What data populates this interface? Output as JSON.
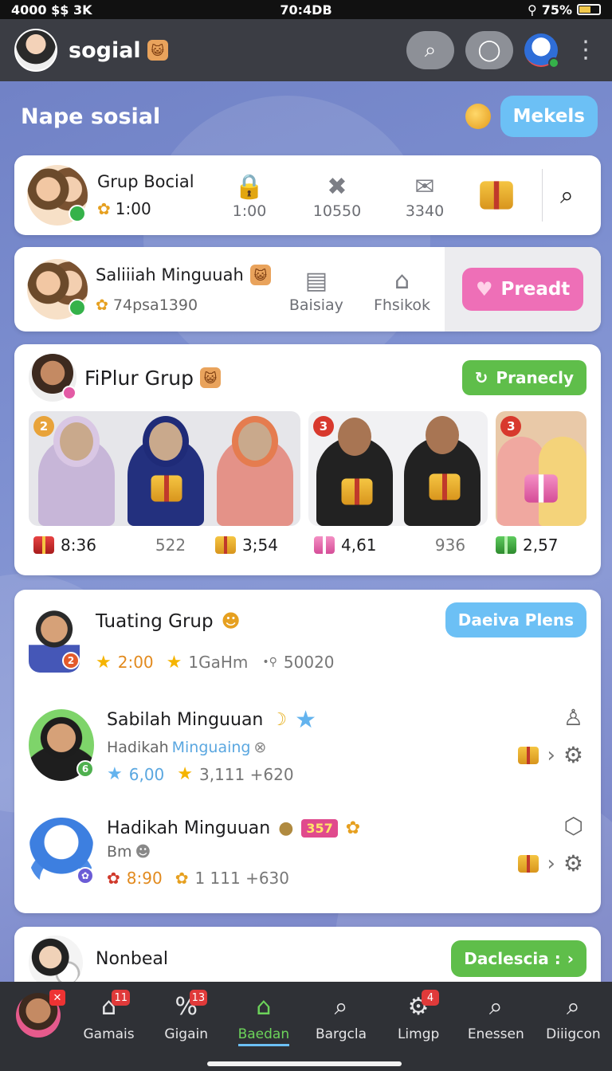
{
  "status_bar": {
    "left": "4000 $$ 3K",
    "time": "70:4DB",
    "right": "75%"
  },
  "app_bar": {
    "title": "sogial",
    "title_emoji": "😺"
  },
  "page": {
    "title": "Nape sosial",
    "action_button": "Mekels"
  },
  "card1": {
    "title": "Grup Bocial",
    "sub_value": "1:00",
    "stats": [
      {
        "icon": "lock-icon",
        "glyph": "🔒",
        "value": "1:00"
      },
      {
        "icon": "tools-icon",
        "glyph": "✖",
        "value": "10550"
      },
      {
        "icon": "mail-icon",
        "glyph": "✉",
        "value": "3340"
      }
    ]
  },
  "card2": {
    "title": "Saliiiah Minguuah",
    "sub_value": "74psa1390",
    "stats": [
      {
        "icon": "document-icon",
        "glyph": "▤",
        "label": "Baisiay"
      },
      {
        "icon": "home-icon",
        "glyph": "⌂",
        "label": "Fhsikok"
      }
    ],
    "button": "Preadt"
  },
  "card3": {
    "title": "FiPlur Grup",
    "button": "Pranecly",
    "photo_badges": [
      "2",
      "3",
      "3"
    ],
    "stats": [
      {
        "gift": "red",
        "value": "8:36"
      },
      {
        "gift": "",
        "value": "522"
      },
      {
        "gift": "gold",
        "value": "3;54"
      },
      {
        "gift": "pink",
        "value": "4,61"
      },
      {
        "gift": "",
        "value": "936"
      },
      {
        "gift": "green",
        "value": "2,57"
      }
    ]
  },
  "card4": {
    "header": {
      "title": "Tuating Grup",
      "button": "Daeiva Plens",
      "badge": "2",
      "stat1": "2:00",
      "stat2": "1GaHm",
      "stat3": "50020"
    },
    "row1": {
      "title": "Sabilah Minguuan",
      "sub_prefix": "Hadikah",
      "sub_highlight": "Minguaing",
      "stat1": "6,00",
      "stat2": "3,111 +620"
    },
    "row2": {
      "title": "Hadikah Minguuan",
      "tag": "357",
      "sub": "Bm",
      "stat1": "8:90",
      "stat2": "1 111 +630"
    }
  },
  "card5": {
    "title": "Nonbeal",
    "button": "Daclescia :"
  },
  "bottom_nav": {
    "items": [
      {
        "label": "Gamais",
        "icon": "home-icon",
        "glyph": "⌂",
        "badge": "11"
      },
      {
        "label": "Gigain",
        "icon": "percent-icon",
        "glyph": "%",
        "badge": "13"
      },
      {
        "label": "Baedan",
        "icon": "store-icon",
        "glyph": "⌂",
        "badge": ""
      },
      {
        "label": "Bargcla",
        "icon": "search-icon",
        "glyph": "⌕",
        "badge": ""
      },
      {
        "label": "Limgp",
        "icon": "settings-icon",
        "glyph": "⚙",
        "badge": "4"
      },
      {
        "label": "Enessen",
        "icon": "search-icon",
        "glyph": "⌕",
        "badge": ""
      },
      {
        "label": "Diiigcon",
        "icon": "search-icon",
        "glyph": "⌕",
        "badge": ""
      }
    ]
  }
}
